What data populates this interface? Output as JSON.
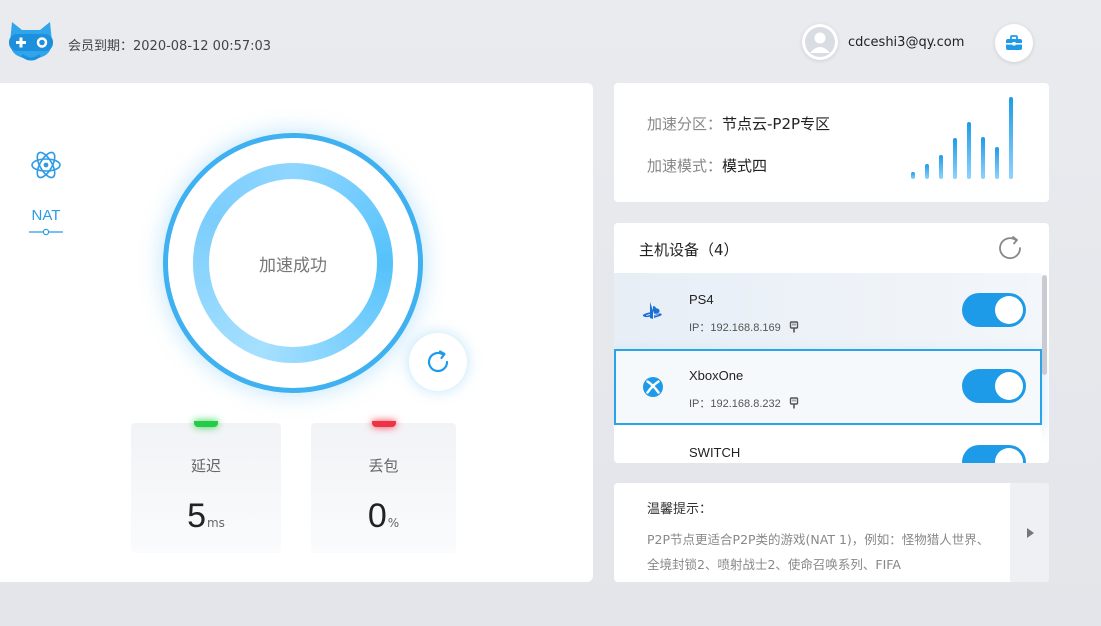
{
  "header": {
    "expiry": "会员到期：2020-08-12 00:57:03",
    "email": "cdceshi3@qy.com"
  },
  "sidebar": {
    "nat_label": "NAT"
  },
  "status": {
    "text": "加速成功"
  },
  "stats": {
    "latency_label": "延迟",
    "latency_value": "5",
    "latency_unit": "ms",
    "latency_color": "#22cc44",
    "loss_label": "丢包",
    "loss_value": "0",
    "loss_unit": "%",
    "loss_color": "#ee3344"
  },
  "zone": {
    "zone_label": "加速分区：",
    "zone_value": "节点云-P2P专区",
    "mode_label": "加速模式：",
    "mode_value": "模式四"
  },
  "devices": {
    "title": "主机设备（4）",
    "items": [
      {
        "name": "PS4",
        "ip": "IP：192.168.8.169",
        "icon": "playstation-icon",
        "enabled": true
      },
      {
        "name": "XboxOne",
        "ip": "IP：192.168.8.232",
        "icon": "xbox-icon",
        "enabled": true
      },
      {
        "name": "SWITCH",
        "ip": "",
        "icon": "switch-icon",
        "enabled": true
      }
    ]
  },
  "tips": {
    "title": "温馨提示：",
    "text": "P2P节点更适合P2P类的游戏(NAT 1)，例如：怪物猎人世界、全境封锁2、喷射战士2、使命召唤系列、FIFA"
  },
  "colors": {
    "accent": "#1e9be8",
    "ring": "#3fb0f0"
  }
}
